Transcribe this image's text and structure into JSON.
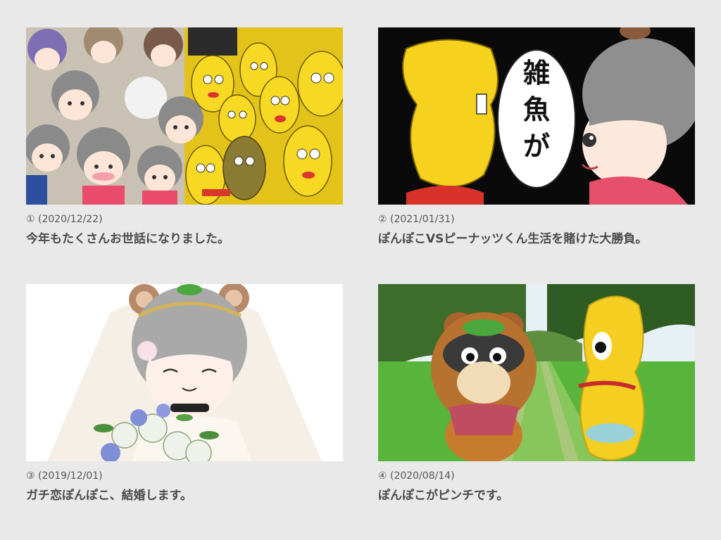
{
  "videos": [
    {
      "meta": "① (2020/12/22)",
      "title": "今年もたくさんお世話になりました。",
      "thumbnail_icon": "crowd-of-characters-thumbnail"
    },
    {
      "meta": "② (2021/01/31)",
      "title": "ぽんぽこVSピーナッツくん生活を賭けた大勝負。",
      "thumbnail_icon": "face-off-thumbnail",
      "speech_bubble": "雑魚が"
    },
    {
      "meta": "③ (2019/12/01)",
      "title": "ガチ恋ぽんぽこ、結婚します。",
      "thumbnail_icon": "wedding-bride-thumbnail"
    },
    {
      "meta": "④ (2020/08/14)",
      "title": "ぽんぽこがピンチです。",
      "thumbnail_icon": "rice-field-costumes-thumbnail"
    }
  ],
  "colors": {
    "background": "#e9e9e9",
    "meta_text": "#555555",
    "title_text": "#4a4a4a",
    "peanut_yellow": "#f5d31c",
    "tanuki_gray": "#8f8f8f"
  }
}
